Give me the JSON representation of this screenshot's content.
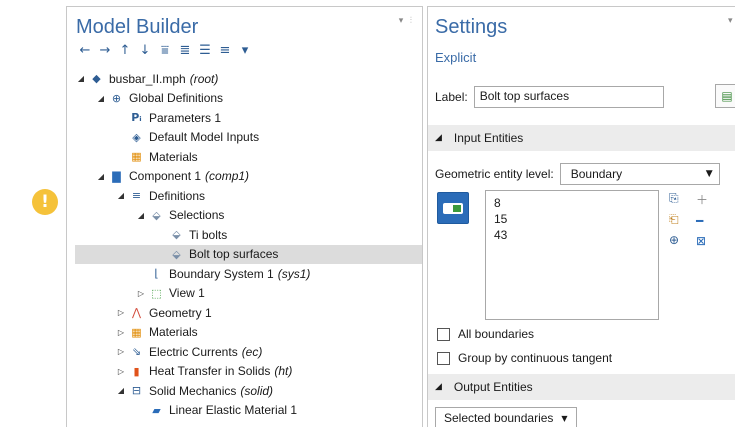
{
  "warning": {
    "symbol": "!",
    "color": "#f5c23a"
  },
  "model_builder": {
    "title": "Model Builder",
    "toolbar": [
      {
        "icon": "back-arrow-icon",
        "glyph": "←"
      },
      {
        "icon": "forward-arrow-icon",
        "glyph": "→"
      },
      {
        "icon": "up-arrow-icon",
        "glyph": "↑"
      },
      {
        "icon": "down-arrow-icon",
        "glyph": "↓"
      },
      {
        "icon": "show-icon",
        "glyph": "⩸"
      },
      {
        "icon": "collapse-icon",
        "glyph": "≣"
      },
      {
        "icon": "expand-icon",
        "glyph": "☰"
      },
      {
        "icon": "more-icon",
        "glyph": "≡"
      },
      {
        "icon": "dropdown-icon",
        "glyph": "▾"
      }
    ],
    "tree": [
      {
        "label": "busbar_II.mph",
        "suffix": "(root)"
      },
      {
        "label": "Global Definitions",
        "suffix": ""
      },
      {
        "label": "Parameters 1",
        "suffix": ""
      },
      {
        "label": "Default Model Inputs",
        "suffix": ""
      },
      {
        "label": "Materials",
        "suffix": ""
      },
      {
        "label": "Component 1",
        "suffix": "(comp1)"
      },
      {
        "label": "Definitions",
        "suffix": ""
      },
      {
        "label": "Selections",
        "suffix": ""
      },
      {
        "label": "Ti bolts",
        "suffix": ""
      },
      {
        "label": "Bolt top surfaces",
        "suffix": ""
      },
      {
        "label": "Boundary System 1",
        "suffix": "(sys1)"
      },
      {
        "label": "View 1",
        "suffix": ""
      },
      {
        "label": "Geometry 1",
        "suffix": ""
      },
      {
        "label": "Materials",
        "suffix": ""
      },
      {
        "label": "Electric Currents",
        "suffix": "(ec)"
      },
      {
        "label": "Heat Transfer in Solids",
        "suffix": "(ht)"
      },
      {
        "label": "Solid Mechanics",
        "suffix": "(solid)"
      },
      {
        "label": "Linear Elastic Material 1",
        "suffix": ""
      }
    ]
  },
  "settings": {
    "title": "Settings",
    "subtitle": "Explicit",
    "label_caption": "Label:",
    "label_value": "Bolt top surfaces",
    "input_section": "Input Entities",
    "geom_level_caption": "Geometric entity level:",
    "geom_level_value": "Boundary",
    "entities": [
      "8",
      "15",
      "43"
    ],
    "all_boundaries": "All boundaries",
    "group_tangent": "Group by continuous tangent",
    "output_section": "Output Entities",
    "output_value": "Selected boundaries"
  }
}
